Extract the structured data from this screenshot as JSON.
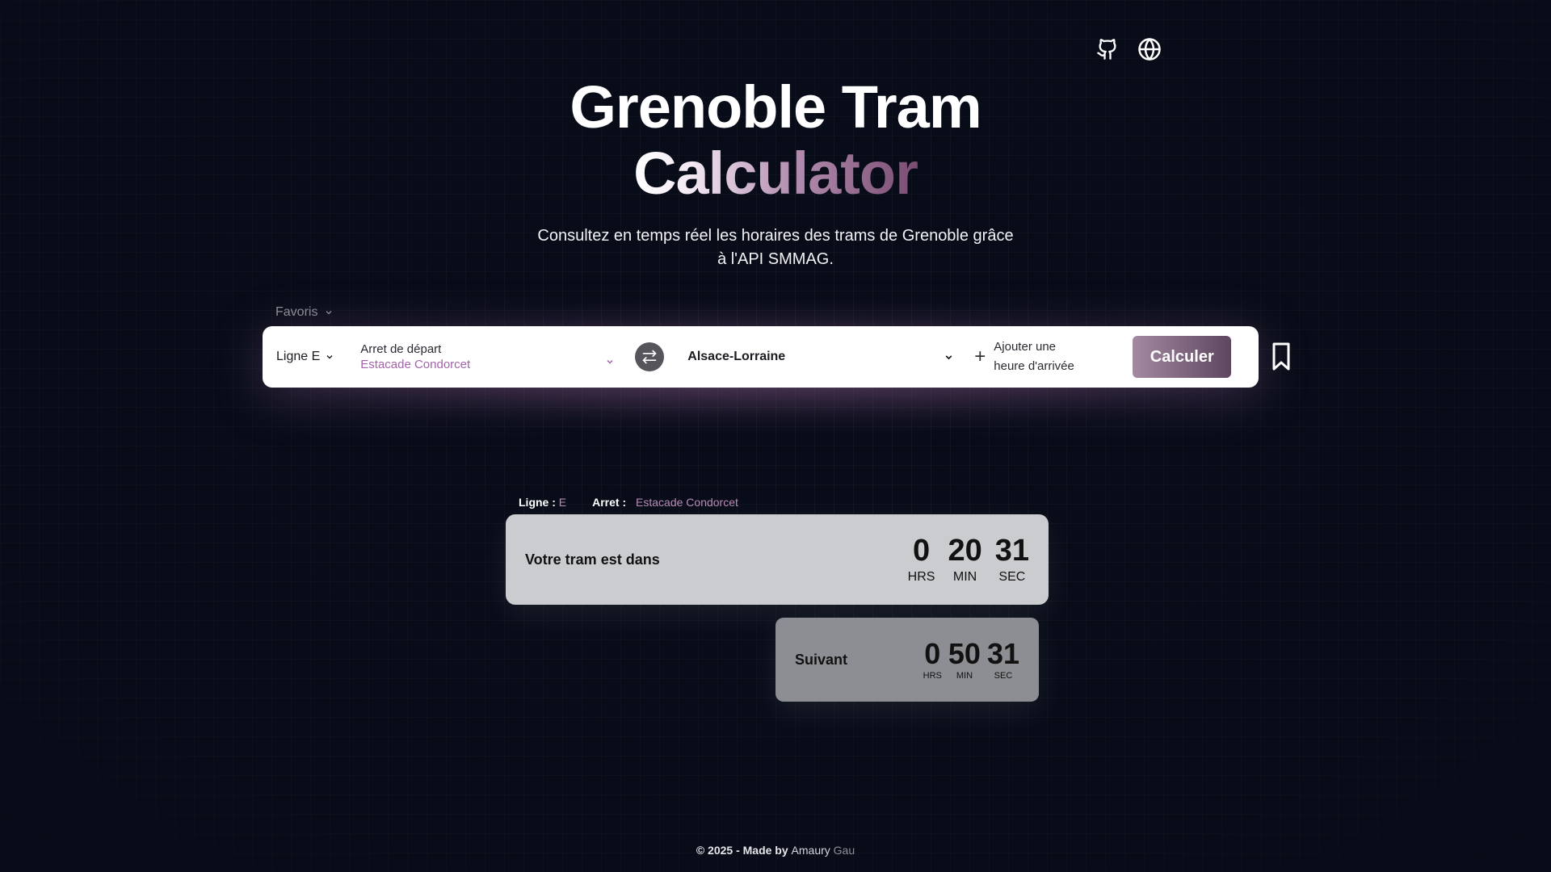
{
  "header": {
    "icons": [
      "github-icon",
      "globe-icon"
    ]
  },
  "hero": {
    "title_line1": "Grenoble Tram",
    "title_line2": "Calculator",
    "subtitle": "Consultez en temps réel les horaires des trams de Grenoble grâce à l'API SMMAG."
  },
  "favorites": {
    "label": "Favoris"
  },
  "search": {
    "line_label": "Ligne E",
    "departure_label": "Arret de départ",
    "departure_value": "Estacade Condorcet",
    "destination_value": "Alsace-Lorraine",
    "arrival_line1": "Ajouter une",
    "arrival_line2": "heure d'arrivée",
    "calculate_label": "Calculer"
  },
  "info": {
    "line_label": "Ligne :",
    "line_value": "E",
    "stop_label": "Arret :",
    "stop_value": "Estacade Condorcet"
  },
  "next_tram": {
    "label": "Votre tram est dans",
    "hours": "0",
    "minutes": "20",
    "seconds": "31",
    "hours_unit": "HRS",
    "minutes_unit": "MIN",
    "seconds_unit": "SEC"
  },
  "following_tram": {
    "label": "Suivant",
    "hours": "0",
    "minutes": "50",
    "seconds": "31",
    "hours_unit": "HRS",
    "minutes_unit": "MIN",
    "seconds_unit": "SEC"
  },
  "footer": {
    "prefix": "© 2025 - Made by",
    "name_first": "Amaury",
    "name_last": "Gau"
  },
  "colors": {
    "background": "#080c18",
    "accent": "#a164a8",
    "card_main": "#cbcccf",
    "card_next": "#8d8e93"
  }
}
